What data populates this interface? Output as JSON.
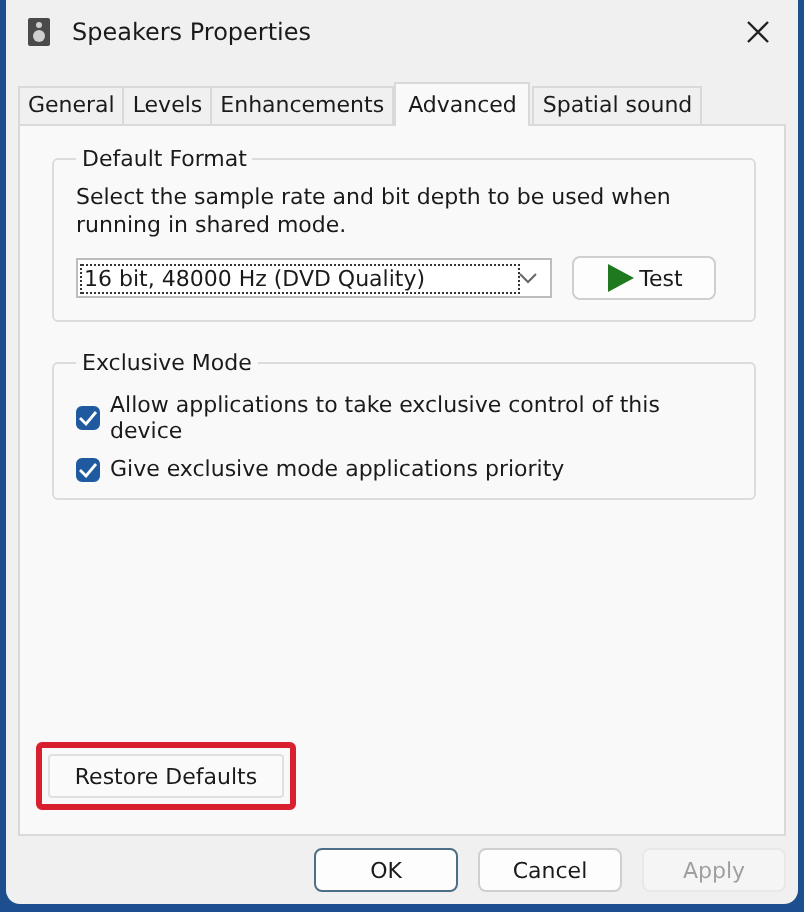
{
  "window": {
    "title": "Speakers Properties"
  },
  "tabs": [
    {
      "label": "General",
      "selected": false
    },
    {
      "label": "Levels",
      "selected": false
    },
    {
      "label": "Enhancements",
      "selected": false
    },
    {
      "label": "Advanced",
      "selected": true
    },
    {
      "label": "Spatial sound",
      "selected": false
    }
  ],
  "default_format": {
    "title": "Default Format",
    "description": "Select the sample rate and bit depth to be used when running in shared mode.",
    "format_value": "16 bit, 48000 Hz (DVD Quality)",
    "test_button": "Test"
  },
  "exclusive_mode": {
    "title": "Exclusive Mode",
    "options": [
      {
        "label": "Allow applications to take exclusive control of this device",
        "checked": true
      },
      {
        "label": "Give exclusive mode applications priority",
        "checked": true
      }
    ]
  },
  "restore_defaults": {
    "label": "Restore Defaults",
    "highlighted": true
  },
  "buttons": [
    {
      "label": "OK",
      "disabled": false,
      "default": true
    },
    {
      "label": "Cancel",
      "disabled": false,
      "default": false
    },
    {
      "label": "Apply",
      "disabled": true,
      "default": false
    }
  ]
}
